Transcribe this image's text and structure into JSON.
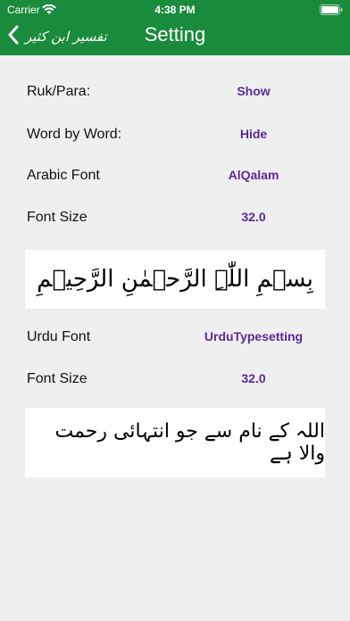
{
  "status_bar": {
    "carrier": "Carrier",
    "time": "4:38 PM"
  },
  "nav": {
    "back_label": "تفسیر ابن کثیر",
    "title": "Setting"
  },
  "settings": [
    {
      "label": "Ruk/Para:",
      "value": "Show"
    },
    {
      "label": "Word by Word:",
      "value": "Hide"
    },
    {
      "label": "Arabic Font",
      "value": "AlQalam"
    },
    {
      "label": "Font Size",
      "value": "32.0"
    },
    {
      "label": "Urdu Font",
      "value": "UrduTypesetting"
    },
    {
      "label": "Font Size",
      "value": "32.0"
    }
  ],
  "previews": {
    "arabic_text": "بِسۡمِ اللّٰہِ الرَّحۡمٰنِ الرَّحِیۡمِ",
    "urdu_text": "اللہ کے نام سے جو انتہائی رحمت والا ہے"
  },
  "colors": {
    "header_bg": "#1a8b3c",
    "value_text": "#5a2a9c",
    "page_bg": "#efefef"
  },
  "icons": {
    "back": "chevron-left-icon",
    "wifi": "wifi-icon",
    "battery": "battery-icon"
  }
}
